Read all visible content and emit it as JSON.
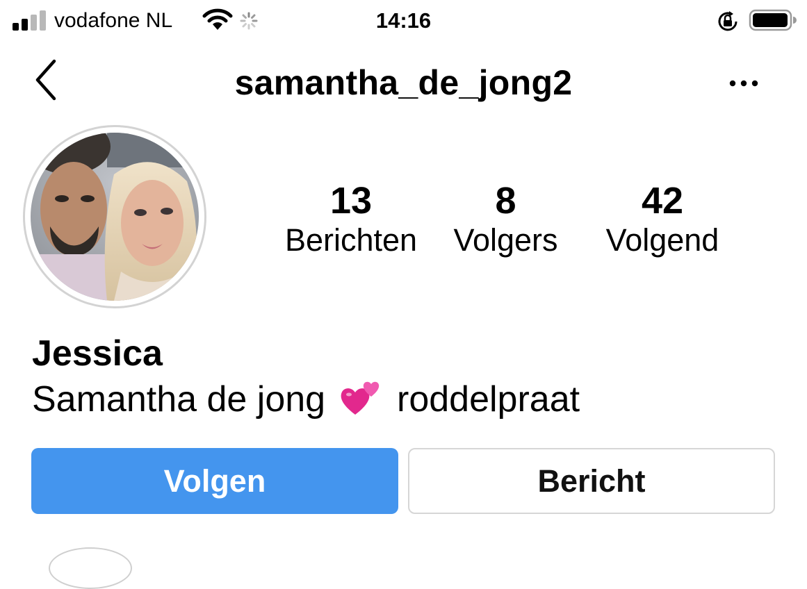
{
  "status_bar": {
    "carrier": "vodafone NL",
    "time": "14:16",
    "signal_bars_filled": 2,
    "signal_bars_total": 4,
    "icons": [
      "signal-icon",
      "wifi-icon",
      "loading-spinner-icon",
      "orientation-lock-icon",
      "battery-icon"
    ]
  },
  "nav": {
    "username": "samantha_de_jong2",
    "back_icon": "chevron-left-icon",
    "more_icon": "ellipsis-icon"
  },
  "profile": {
    "avatar": "profile-photo",
    "stats": {
      "posts": {
        "value": "13",
        "label": "Berichten"
      },
      "followers": {
        "value": "8",
        "label": "Volgers"
      },
      "following": {
        "value": "42",
        "label": "Volgend"
      }
    },
    "display_name": "Jessica",
    "bio_before": "Samantha de jong",
    "bio_emoji": "💕",
    "bio_after": "roddelpraat"
  },
  "actions": {
    "follow_label": "Volgen",
    "message_label": "Bericht"
  },
  "colors": {
    "follow_button": "#4495ee",
    "button_border": "#d6d6d6",
    "avatar_ring": "#d3d3d3"
  }
}
